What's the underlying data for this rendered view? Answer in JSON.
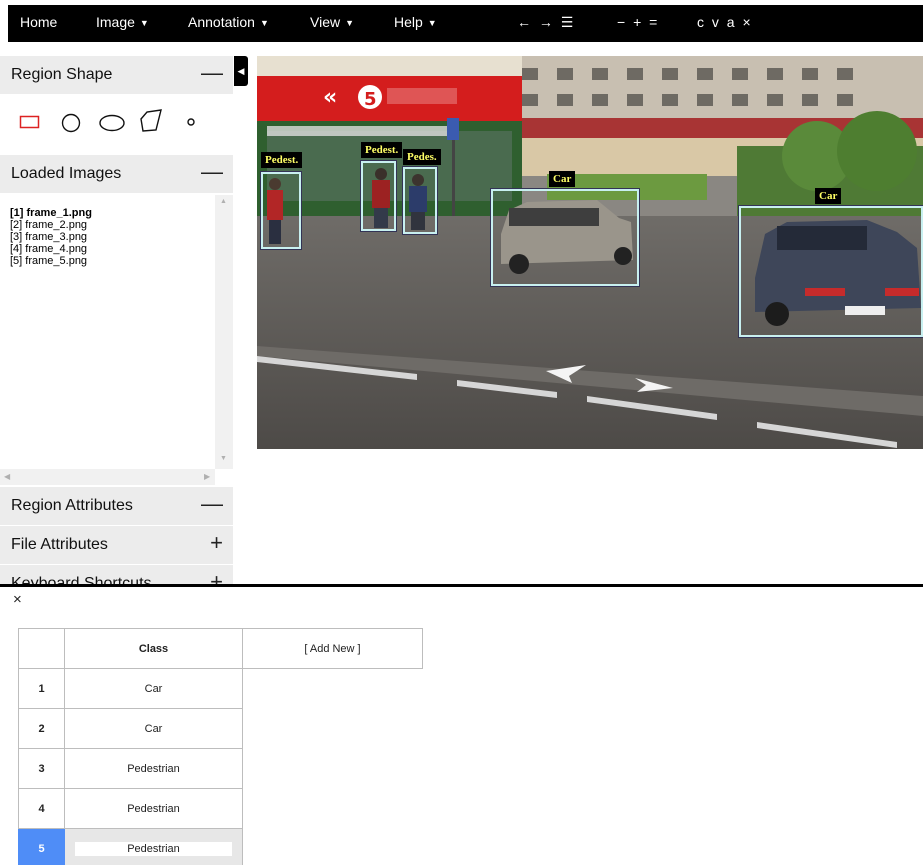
{
  "menu": {
    "items": [
      {
        "label": "Home",
        "caret": ""
      },
      {
        "label": "Image",
        "caret": "▼"
      },
      {
        "label": "Annotation",
        "caret": "▼"
      },
      {
        "label": "View",
        "caret": "▼"
      },
      {
        "label": "Help",
        "caret": "▼"
      }
    ],
    "nav_tools": "← → ☰",
    "zoom_tools": "− + =",
    "edit_tools": "c v a ×"
  },
  "left_panel": {
    "region_shape": {
      "title": "Region Shape",
      "ctrl": "—"
    },
    "shapes": [
      "rectangle",
      "circle",
      "ellipse",
      "polygon",
      "point"
    ],
    "loaded_images": {
      "title": "Loaded Images",
      "ctrl": "—",
      "files": [
        "[1] frame_1.png",
        "[2] frame_2.png",
        "[3] frame_3.png",
        "[4] frame_4.png",
        "[5] frame_5.png"
      ],
      "active_index": 0
    },
    "region_attributes": {
      "title": "Region Attributes",
      "ctrl": "—"
    },
    "file_attributes": {
      "title": "File Attributes",
      "ctrl": "+"
    },
    "keyboard_shortcuts": {
      "title": "Keyboard Shortcuts",
      "ctrl": "+"
    },
    "collapse_icon": "◀"
  },
  "canvas": {
    "regions": [
      {
        "label": "Pedest."
      },
      {
        "label": "Pedest."
      },
      {
        "label": "Pedes."
      },
      {
        "label": "Car"
      },
      {
        "label": "Car"
      }
    ],
    "storefront_number": "5"
  },
  "attributes_table": {
    "close_label": "×",
    "header": "Class",
    "add_new": "[ Add New ]",
    "rows": [
      {
        "index": "1",
        "class": "Car"
      },
      {
        "index": "2",
        "class": "Car"
      },
      {
        "index": "3",
        "class": "Pedestrian"
      },
      {
        "index": "4",
        "class": "Pedestrian"
      },
      {
        "index": "5",
        "class": "Pedestrian"
      }
    ],
    "selected_row": 4
  },
  "colors": {
    "menu_bg": "#000000",
    "panel_header_bg": "#ececec",
    "region_border": "#c8f0f0",
    "label_text": "#ffff66",
    "selected_row": "#4f8df7",
    "shape_icon_active": "#dd2222"
  }
}
